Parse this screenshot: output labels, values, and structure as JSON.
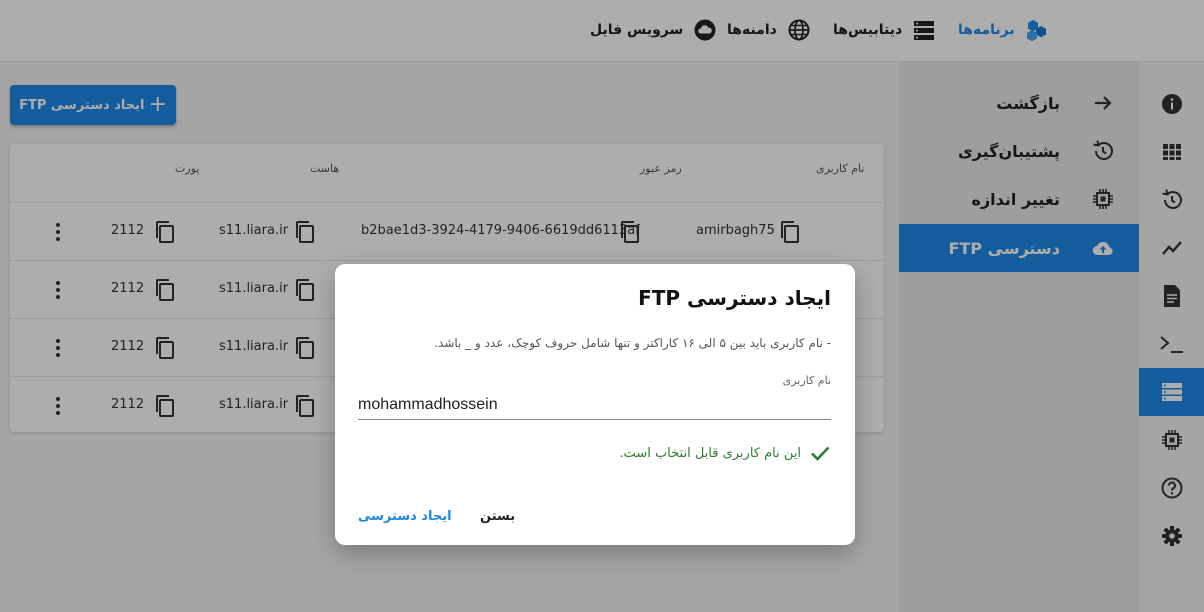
{
  "topnav": [
    {
      "label": "برنامه‌ها",
      "icon": "apps-cube-icon",
      "active": true
    },
    {
      "label": "دیتابیس‌ها",
      "icon": "database-icon",
      "active": false
    },
    {
      "label": "دامنه‌ها",
      "icon": "globe-icon",
      "active": false
    },
    {
      "label": "سرویس فایل",
      "icon": "cloud-icon",
      "active": false
    }
  ],
  "create_button": {
    "label": "ایجاد دسترسی FTP",
    "icon": "plus-icon"
  },
  "table": {
    "columns": [
      "نام کاربری",
      "رمز عبور",
      "هاست",
      "پورت"
    ],
    "rows": [
      {
        "username": "amirbagh75",
        "password": "b2bae1d3-3924-4179-9406-6619dd6113af",
        "host": "s11.liara.ir",
        "port": "2112"
      },
      {
        "username": "",
        "password": "",
        "host": "s11.liara.ir",
        "port": "2112"
      },
      {
        "username": "",
        "password": "",
        "host": "s11.liara.ir",
        "port": "2112"
      },
      {
        "username": "",
        "password": "",
        "host": "s11.liara.ir",
        "port": "2112"
      }
    ]
  },
  "sidebar": {
    "items": [
      {
        "label": "بازگشت",
        "icon": "arrow-right-icon",
        "active": false
      },
      {
        "label": "پشتیبان‌گیری",
        "icon": "history-icon",
        "active": false
      },
      {
        "label": "تغییر اندازه",
        "icon": "chip-icon",
        "active": false
      },
      {
        "label": "دسترسی FTP",
        "icon": "cloud-upload-icon",
        "active": true
      }
    ]
  },
  "rail": [
    {
      "icon": "info-icon",
      "active": false
    },
    {
      "icon": "grid-icon",
      "active": false
    },
    {
      "icon": "history-icon",
      "active": false
    },
    {
      "icon": "chart-line-icon",
      "active": false
    },
    {
      "icon": "document-icon",
      "active": false
    },
    {
      "icon": "terminal-icon",
      "active": false
    },
    {
      "icon": "storage-icon",
      "active": true
    },
    {
      "icon": "chip-icon",
      "active": false
    },
    {
      "icon": "help-icon",
      "active": false
    },
    {
      "icon": "settings-icon",
      "active": false
    }
  ],
  "dialog": {
    "title": "ایجاد دسترسی FTP",
    "hint": "- نام کاربری باید بین ۵ الی ۱۶ کاراکتر و تنها شامل حروف کوچک، عدد و _ باشد.",
    "field_label": "نام کاربری",
    "field_value": "mohammadhossein",
    "success_message": "این نام کاربری قابل انتخاب است.",
    "close_label": "بستن",
    "submit_label": "ایجاد دسترسی"
  },
  "colors": {
    "accent": "#1e88e5",
    "success": "#2e7d32",
    "overlay": "rgba(0,0,0,0.32)"
  }
}
